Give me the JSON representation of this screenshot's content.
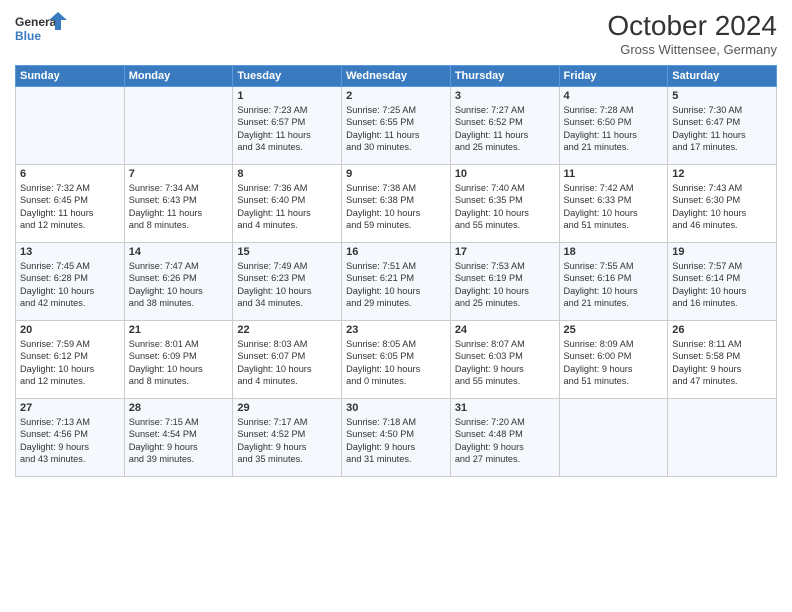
{
  "logo": {
    "line1": "General",
    "line2": "Blue"
  },
  "title": "October 2024",
  "subtitle": "Gross Wittensee, Germany",
  "weekdays": [
    "Sunday",
    "Monday",
    "Tuesday",
    "Wednesday",
    "Thursday",
    "Friday",
    "Saturday"
  ],
  "weeks": [
    [
      {
        "day": "",
        "content": ""
      },
      {
        "day": "",
        "content": ""
      },
      {
        "day": "1",
        "content": "Sunrise: 7:23 AM\nSunset: 6:57 PM\nDaylight: 11 hours\nand 34 minutes."
      },
      {
        "day": "2",
        "content": "Sunrise: 7:25 AM\nSunset: 6:55 PM\nDaylight: 11 hours\nand 30 minutes."
      },
      {
        "day": "3",
        "content": "Sunrise: 7:27 AM\nSunset: 6:52 PM\nDaylight: 11 hours\nand 25 minutes."
      },
      {
        "day": "4",
        "content": "Sunrise: 7:28 AM\nSunset: 6:50 PM\nDaylight: 11 hours\nand 21 minutes."
      },
      {
        "day": "5",
        "content": "Sunrise: 7:30 AM\nSunset: 6:47 PM\nDaylight: 11 hours\nand 17 minutes."
      }
    ],
    [
      {
        "day": "6",
        "content": "Sunrise: 7:32 AM\nSunset: 6:45 PM\nDaylight: 11 hours\nand 12 minutes."
      },
      {
        "day": "7",
        "content": "Sunrise: 7:34 AM\nSunset: 6:43 PM\nDaylight: 11 hours\nand 8 minutes."
      },
      {
        "day": "8",
        "content": "Sunrise: 7:36 AM\nSunset: 6:40 PM\nDaylight: 11 hours\nand 4 minutes."
      },
      {
        "day": "9",
        "content": "Sunrise: 7:38 AM\nSunset: 6:38 PM\nDaylight: 10 hours\nand 59 minutes."
      },
      {
        "day": "10",
        "content": "Sunrise: 7:40 AM\nSunset: 6:35 PM\nDaylight: 10 hours\nand 55 minutes."
      },
      {
        "day": "11",
        "content": "Sunrise: 7:42 AM\nSunset: 6:33 PM\nDaylight: 10 hours\nand 51 minutes."
      },
      {
        "day": "12",
        "content": "Sunrise: 7:43 AM\nSunset: 6:30 PM\nDaylight: 10 hours\nand 46 minutes."
      }
    ],
    [
      {
        "day": "13",
        "content": "Sunrise: 7:45 AM\nSunset: 6:28 PM\nDaylight: 10 hours\nand 42 minutes."
      },
      {
        "day": "14",
        "content": "Sunrise: 7:47 AM\nSunset: 6:26 PM\nDaylight: 10 hours\nand 38 minutes."
      },
      {
        "day": "15",
        "content": "Sunrise: 7:49 AM\nSunset: 6:23 PM\nDaylight: 10 hours\nand 34 minutes."
      },
      {
        "day": "16",
        "content": "Sunrise: 7:51 AM\nSunset: 6:21 PM\nDaylight: 10 hours\nand 29 minutes."
      },
      {
        "day": "17",
        "content": "Sunrise: 7:53 AM\nSunset: 6:19 PM\nDaylight: 10 hours\nand 25 minutes."
      },
      {
        "day": "18",
        "content": "Sunrise: 7:55 AM\nSunset: 6:16 PM\nDaylight: 10 hours\nand 21 minutes."
      },
      {
        "day": "19",
        "content": "Sunrise: 7:57 AM\nSunset: 6:14 PM\nDaylight: 10 hours\nand 16 minutes."
      }
    ],
    [
      {
        "day": "20",
        "content": "Sunrise: 7:59 AM\nSunset: 6:12 PM\nDaylight: 10 hours\nand 12 minutes."
      },
      {
        "day": "21",
        "content": "Sunrise: 8:01 AM\nSunset: 6:09 PM\nDaylight: 10 hours\nand 8 minutes."
      },
      {
        "day": "22",
        "content": "Sunrise: 8:03 AM\nSunset: 6:07 PM\nDaylight: 10 hours\nand 4 minutes."
      },
      {
        "day": "23",
        "content": "Sunrise: 8:05 AM\nSunset: 6:05 PM\nDaylight: 10 hours\nand 0 minutes."
      },
      {
        "day": "24",
        "content": "Sunrise: 8:07 AM\nSunset: 6:03 PM\nDaylight: 9 hours\nand 55 minutes."
      },
      {
        "day": "25",
        "content": "Sunrise: 8:09 AM\nSunset: 6:00 PM\nDaylight: 9 hours\nand 51 minutes."
      },
      {
        "day": "26",
        "content": "Sunrise: 8:11 AM\nSunset: 5:58 PM\nDaylight: 9 hours\nand 47 minutes."
      }
    ],
    [
      {
        "day": "27",
        "content": "Sunrise: 7:13 AM\nSunset: 4:56 PM\nDaylight: 9 hours\nand 43 minutes."
      },
      {
        "day": "28",
        "content": "Sunrise: 7:15 AM\nSunset: 4:54 PM\nDaylight: 9 hours\nand 39 minutes."
      },
      {
        "day": "29",
        "content": "Sunrise: 7:17 AM\nSunset: 4:52 PM\nDaylight: 9 hours\nand 35 minutes."
      },
      {
        "day": "30",
        "content": "Sunrise: 7:18 AM\nSunset: 4:50 PM\nDaylight: 9 hours\nand 31 minutes."
      },
      {
        "day": "31",
        "content": "Sunrise: 7:20 AM\nSunset: 4:48 PM\nDaylight: 9 hours\nand 27 minutes."
      },
      {
        "day": "",
        "content": ""
      },
      {
        "day": "",
        "content": ""
      }
    ]
  ]
}
